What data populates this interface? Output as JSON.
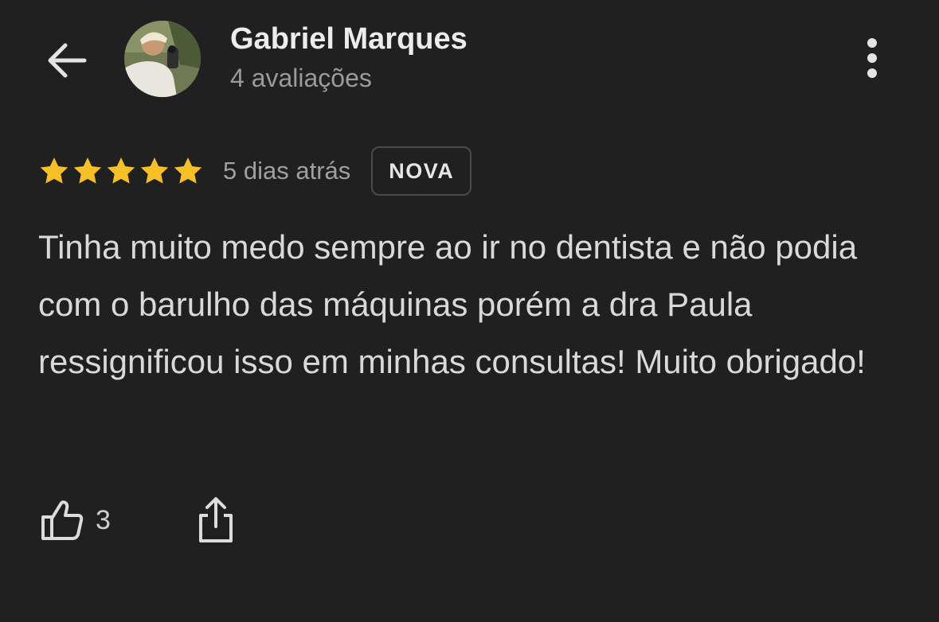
{
  "header": {
    "back_icon": "arrow-left-icon",
    "user_name": "Gabriel Marques",
    "review_count": "4 avaliações",
    "more_icon": "more-vertical-icon"
  },
  "review": {
    "rating": 5,
    "rating_max": 5,
    "star_color": "#F6C026",
    "date": "5 dias atrás",
    "badge": "NOVA",
    "text": "Tinha muito medo sempre ao ir no dentista e não podia com o barulho das máquinas porém a dra Paula ressignificou isso em minhas consultas! Muito obrigado!"
  },
  "actions": {
    "like_icon": "thumbs-up-icon",
    "like_count": "3",
    "share_icon": "share-icon"
  }
}
